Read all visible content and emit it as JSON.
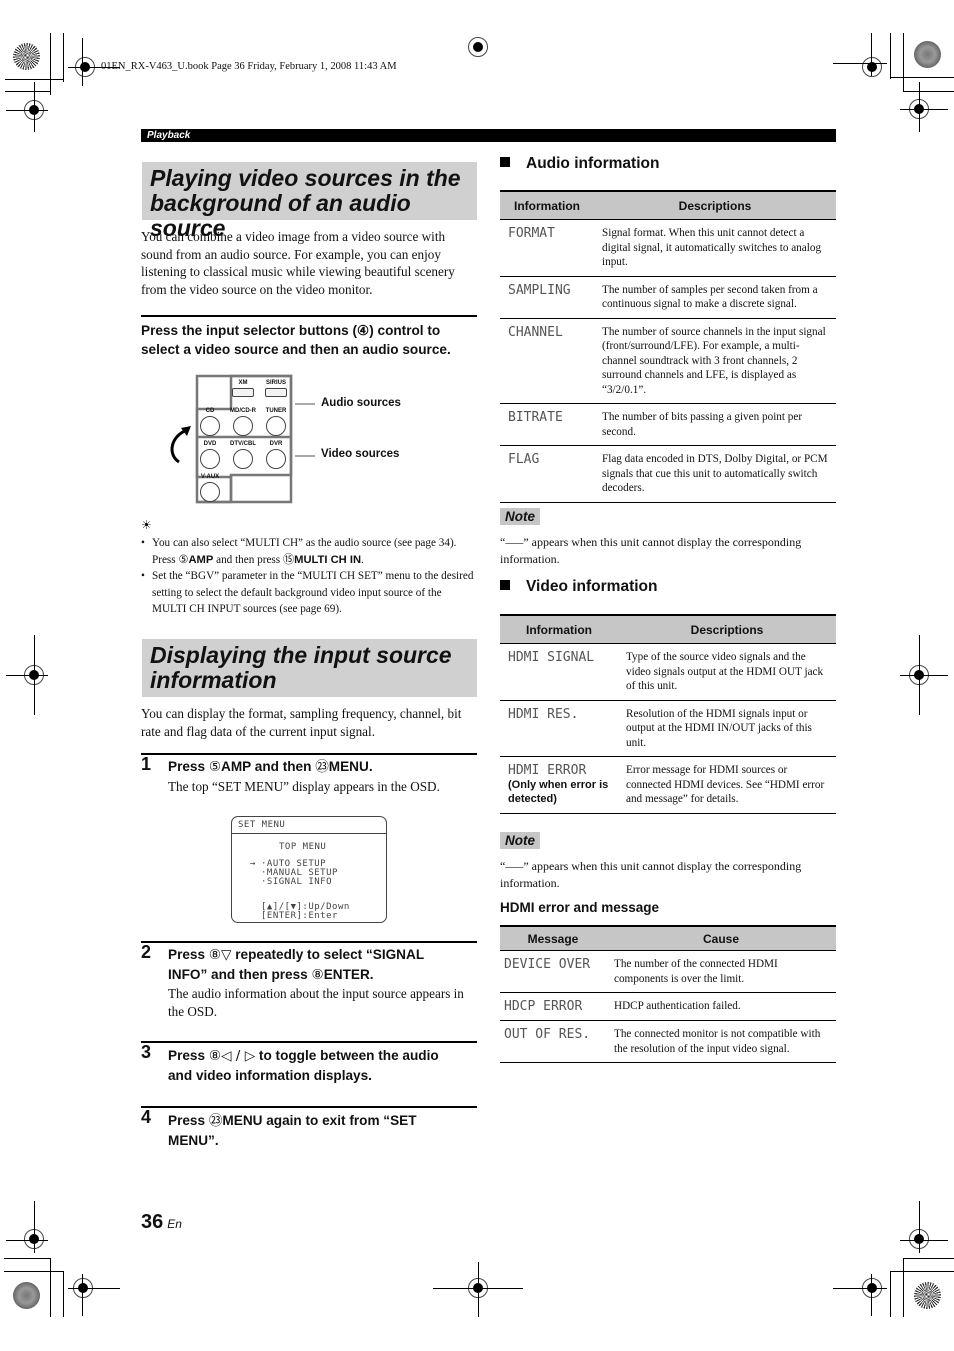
{
  "print_header": "01EN_RX-V463_U.book  Page 36  Friday, February 1, 2008  11:43 AM",
  "section_label": "Playback",
  "left": {
    "section1": {
      "title_line1": "Playing video sources in the",
      "title_line2": "background of an audio source",
      "intro": "You can combine a video image from a video source with sound from an audio source. For example, you can enjoy listening to classical music while viewing beautiful scenery from the video source on the video monitor.",
      "instruction": "Press the input selector buttons (④) control to select a video source and then an audio source.",
      "diagram": {
        "audio_buttons_top": [
          "XM",
          "SIRIUS"
        ],
        "audio_buttons": [
          "CD",
          "MD/CD-R",
          "TUNER"
        ],
        "video_buttons": [
          "DVD",
          "DTV/CBL",
          "DVR"
        ],
        "video_buttons_extra": [
          "V-AUX"
        ],
        "audio_label": "Audio sources",
        "video_label": "Video sources"
      },
      "tips": [
        {
          "pre": "You can also select “MULTI CH” as the audio source (see page 34). Press ",
          "k1num": "⑤",
          "k1": "AMP",
          "mid": " and then press ",
          "k2num": "⑮",
          "k2": "MULTI CH IN",
          "post": "."
        },
        {
          "text": "Set the “BGV” parameter in the “MULTI CH SET” menu to the desired setting to select the default background video input source of the MULTI CH INPUT sources (see page 69)."
        }
      ]
    },
    "section2": {
      "title_line1": "Displaying the input source",
      "title_line2": "information",
      "intro": "You can display the format, sampling frequency, channel, bit rate and flag data of the current input signal.",
      "steps": [
        {
          "num": "1",
          "pre": "Press ",
          "k1num": "⑤",
          "k1": "AMP",
          "mid": " and then ",
          "k2num": "㉓",
          "k2": "MENU",
          "post": ".",
          "sub": "The top “SET MENU” display appears in the OSD."
        },
        {
          "num": "2",
          "line1_pre": "Press ",
          "k1num": "⑧",
          "k1": "▽",
          "line1_post": " repeatedly to select “SIGNAL",
          "line2_pre": "INFO” and then press ",
          "k2num": "⑧",
          "k2": "ENTER",
          "line2_post": ".",
          "sub": "The audio information about the input source appears in the OSD."
        },
        {
          "num": "3",
          "line1_pre": "Press ",
          "k1num": "⑧",
          "k1": "◁ / ▷",
          "line1_post": " to toggle between the audio",
          "line2": "and video information displays."
        },
        {
          "num": "4",
          "line1_pre": "Press ",
          "k1num": "㉓",
          "k1": "MENU",
          "line1_post": " again to exit from “SET",
          "line2": "MENU”."
        }
      ],
      "osd": {
        "title": "SET MENU",
        "heading": "TOP MENU",
        "cursor": "→",
        "items": [
          "·AUTO SETUP",
          "·MANUAL SETUP",
          "·SIGNAL INFO"
        ],
        "help1": "[▲]/[▼]:Up/Down",
        "help2": "[ENTER]:Enter"
      }
    }
  },
  "right": {
    "audio": {
      "heading": "Audio information",
      "columns": [
        "Information",
        "Descriptions"
      ],
      "rows": [
        {
          "key": "FORMAT",
          "desc": "Signal format. When this unit cannot detect a digital signal, it automatically switches to analog input."
        },
        {
          "key": "SAMPLING",
          "desc": "The number of samples per second taken from a continuous signal to make a discrete signal."
        },
        {
          "key": "CHANNEL",
          "desc": "The number of source channels in the input signal (front/surround/LFE). For example, a multi-channel soundtrack with 3 front channels, 2 surround channels and LFE, is displayed as “3/2/0.1”."
        },
        {
          "key": "BITRATE",
          "desc": "The number of bits passing a given point per second."
        },
        {
          "key": "FLAG",
          "desc": "Flag data encoded in DTS, Dolby Digital, or PCM signals that cue this unit to automatically switch decoders."
        }
      ],
      "note_label": "Note",
      "note": "“–––” appears when this unit cannot display the corresponding information."
    },
    "video": {
      "heading": "Video information",
      "columns": [
        "Information",
        "Descriptions"
      ],
      "rows": [
        {
          "key": "HDMI SIGNAL",
          "desc": "Type of the source video signals and the video signals output at the HDMI OUT jack of this unit."
        },
        {
          "key": "HDMI RES.",
          "desc": "Resolution of the HDMI signals input or output at the HDMI IN/OUT jacks of this unit."
        },
        {
          "key": "HDMI ERROR",
          "qualifier": "(Only when error is detected)",
          "desc": "Error message for HDMI sources or connected HDMI devices. See “HDMI error and message” for details."
        }
      ],
      "note_label": "Note",
      "note": "“–––” appears when this unit cannot display the corresponding information."
    },
    "hdmi": {
      "heading": "HDMI error and message",
      "columns": [
        "Message",
        "Cause"
      ],
      "rows": [
        {
          "key": "DEVICE OVER",
          "desc": "The number of the connected HDMI components is over the limit."
        },
        {
          "key": "HDCP ERROR",
          "desc": "HDCP authentication failed."
        },
        {
          "key": "OUT OF RES.",
          "desc": "The connected monitor is not compatible with the resolution of the input video signal."
        }
      ]
    }
  },
  "footer": {
    "page_number": "36",
    "lang": "En"
  }
}
